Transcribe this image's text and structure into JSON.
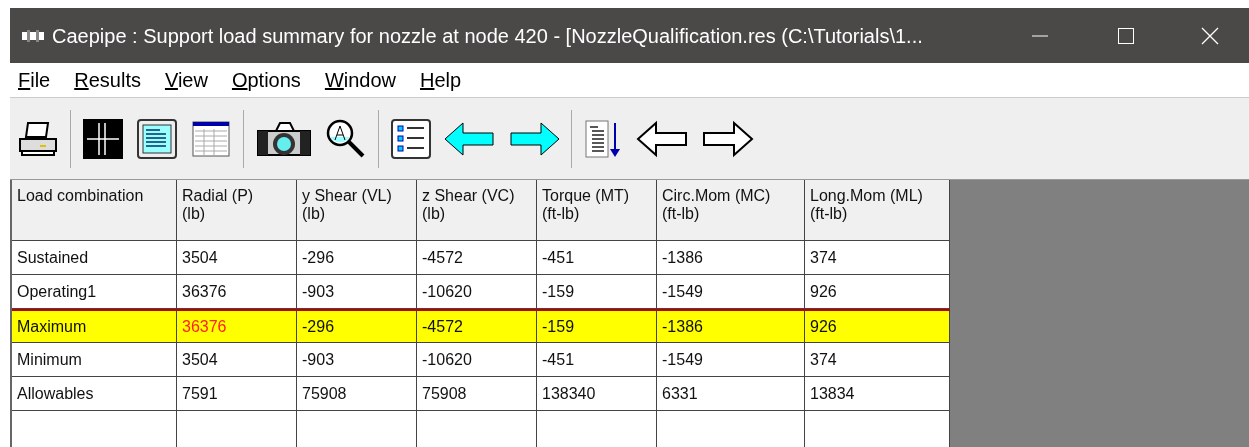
{
  "window": {
    "title": "Caepipe : Support load summary for nozzle at node 420 -  [NozzleQualification.res (C:\\Tutorials\\1..."
  },
  "menu": [
    "File",
    "Results",
    "View",
    "Options",
    "Window",
    "Help"
  ],
  "toolbar": [
    {
      "kind": "printer"
    },
    {
      "kind": "separator"
    },
    {
      "kind": "crosshair"
    },
    {
      "kind": "document"
    },
    {
      "kind": "table"
    },
    {
      "kind": "separator"
    },
    {
      "kind": "camera"
    },
    {
      "kind": "magnifier"
    },
    {
      "kind": "separator"
    },
    {
      "kind": "list"
    },
    {
      "kind": "cyan-left"
    },
    {
      "kind": "cyan-right"
    },
    {
      "kind": "separator"
    },
    {
      "kind": "doc-down"
    },
    {
      "kind": "outline-left"
    },
    {
      "kind": "outline-right"
    }
  ],
  "table": {
    "columns": [
      {
        "label": "Load combination"
      },
      {
        "label": "Radial (P)",
        "unit": "(lb)"
      },
      {
        "label": "y Shear (VL)",
        "unit": "(lb)"
      },
      {
        "label": "z Shear (VC)",
        "unit": "(lb)"
      },
      {
        "label": "Torque (MT)",
        "unit": "(ft-lb)"
      },
      {
        "label": "Circ.Mom (MC)",
        "unit": "(ft-lb)"
      },
      {
        "label": "Long.Mom (ML)",
        "unit": "(ft-lb)"
      }
    ],
    "rows": [
      {
        "highlighted": false,
        "cells": [
          {
            "text": "Sustained",
            "exceeded": false
          },
          {
            "text": "3504",
            "exceeded": false
          },
          {
            "text": "-296",
            "exceeded": false
          },
          {
            "text": "-4572",
            "exceeded": false
          },
          {
            "text": "-451",
            "exceeded": false
          },
          {
            "text": "-1386",
            "exceeded": false
          },
          {
            "text": "374",
            "exceeded": false
          }
        ]
      },
      {
        "highlighted": false,
        "cells": [
          {
            "text": "Operating1",
            "exceeded": false
          },
          {
            "text": "36376",
            "exceeded": false
          },
          {
            "text": "-903",
            "exceeded": false
          },
          {
            "text": "-10620",
            "exceeded": false
          },
          {
            "text": "-159",
            "exceeded": false
          },
          {
            "text": "-1549",
            "exceeded": false
          },
          {
            "text": "926",
            "exceeded": false
          }
        ]
      },
      {
        "highlighted": true,
        "cells": [
          {
            "text": "Maximum",
            "exceeded": false
          },
          {
            "text": "36376",
            "exceeded": true
          },
          {
            "text": "-296",
            "exceeded": false
          },
          {
            "text": "-4572",
            "exceeded": false
          },
          {
            "text": "-159",
            "exceeded": false
          },
          {
            "text": "-1386",
            "exceeded": false
          },
          {
            "text": "926",
            "exceeded": false
          }
        ]
      },
      {
        "highlighted": false,
        "cells": [
          {
            "text": "Minimum",
            "exceeded": false
          },
          {
            "text": "3504",
            "exceeded": false
          },
          {
            "text": "-903",
            "exceeded": false
          },
          {
            "text": "-10620",
            "exceeded": false
          },
          {
            "text": "-451",
            "exceeded": false
          },
          {
            "text": "-1549",
            "exceeded": false
          },
          {
            "text": "374",
            "exceeded": false
          }
        ]
      },
      {
        "highlighted": false,
        "cells": [
          {
            "text": "Allowables",
            "exceeded": false
          },
          {
            "text": "7591",
            "exceeded": false
          },
          {
            "text": "75908",
            "exceeded": false
          },
          {
            "text": "75908",
            "exceeded": false
          },
          {
            "text": "138340",
            "exceeded": false
          },
          {
            "text": "6331",
            "exceeded": false
          },
          {
            "text": "13834",
            "exceeded": false
          }
        ]
      }
    ]
  }
}
